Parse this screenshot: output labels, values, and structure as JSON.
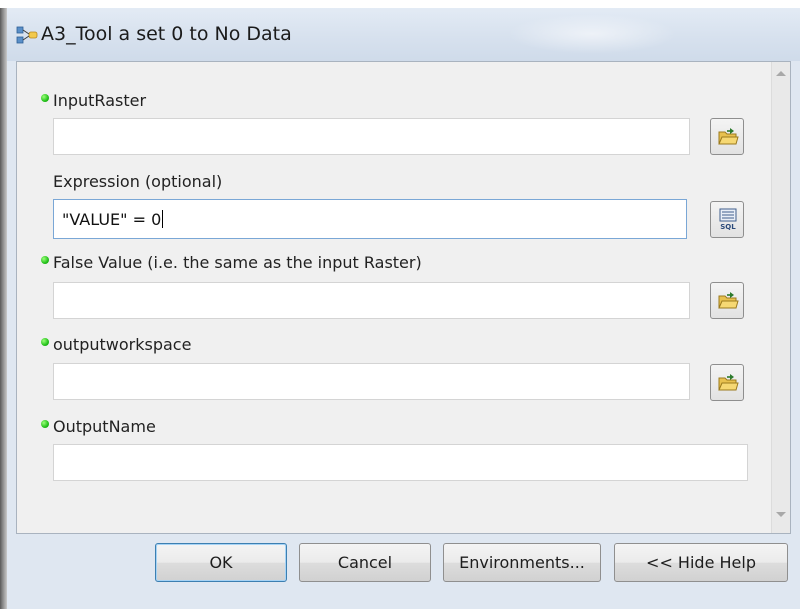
{
  "window": {
    "title": "A3_Tool a set 0 to No Data"
  },
  "parameters": [
    {
      "label": "InputRaster",
      "required": true,
      "value": "",
      "button_icon": "folder-icon"
    },
    {
      "label": "Expression (optional)",
      "required": false,
      "value": "\"VALUE\" = 0",
      "button_icon": "sql-icon",
      "button_text": "SQL"
    },
    {
      "label": "False Value (i.e. the same as the input Raster)",
      "required": true,
      "value": "",
      "button_icon": "folder-icon"
    },
    {
      "label": "outputworkspace",
      "required": true,
      "value": "",
      "button_icon": "folder-icon"
    },
    {
      "label": "OutputName",
      "required": true,
      "value": ""
    }
  ],
  "buttons": {
    "ok": "OK",
    "cancel": "Cancel",
    "environments": "Environments...",
    "hide_help": "<< Hide Help"
  },
  "colors": {
    "required_bullet": "#23c11a",
    "default_button_border": "#3c7fb1",
    "title_bar": "#d7e1ee"
  }
}
